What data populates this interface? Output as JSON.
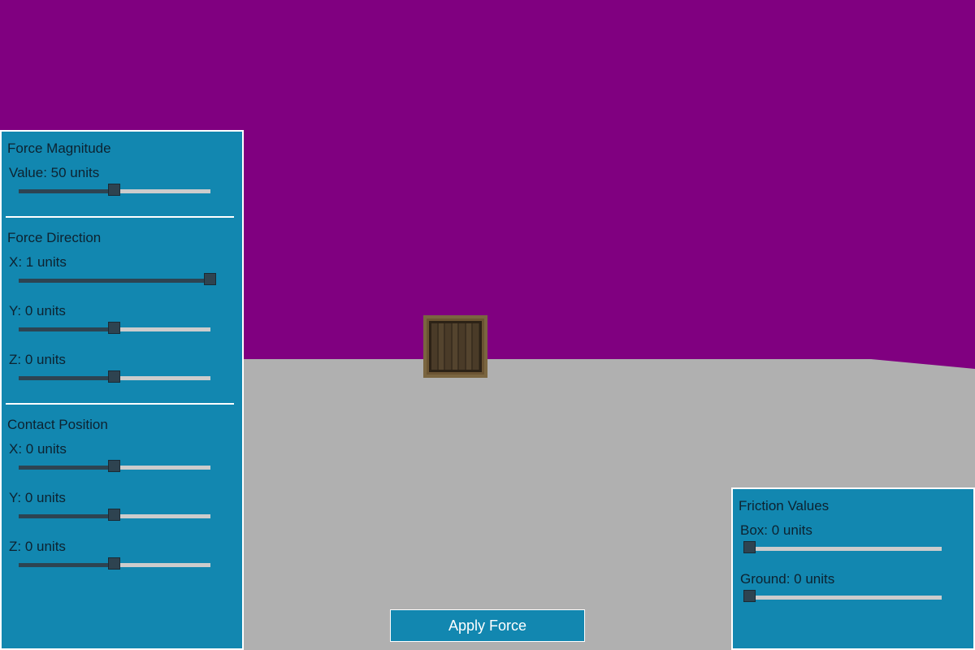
{
  "scene": {
    "sky_color": "#800080",
    "ground_color": "#b0b0b0",
    "object": "wooden-crate"
  },
  "force_magnitude": {
    "title": "Force Magnitude",
    "value": {
      "label": "Value: 50 units",
      "fraction": 0.5
    }
  },
  "force_direction": {
    "title": "Force Direction",
    "x": {
      "label": "X: 1 units",
      "fraction": 1.0
    },
    "y": {
      "label": "Y: 0 units",
      "fraction": 0.5
    },
    "z": {
      "label": "Z: 0 units",
      "fraction": 0.5
    }
  },
  "contact_position": {
    "title": "Contact Position",
    "x": {
      "label": "X: 0 units",
      "fraction": 0.5
    },
    "y": {
      "label": "Y: 0 units",
      "fraction": 0.5
    },
    "z": {
      "label": "Z: 0 units",
      "fraction": 0.5
    }
  },
  "friction": {
    "title": "Friction Values",
    "box": {
      "label": "Box: 0 units",
      "fraction": 0.0
    },
    "ground": {
      "label": "Ground: 0 units",
      "fraction": 0.0
    }
  },
  "apply_button": {
    "label": "Apply Force"
  },
  "colors": {
    "panel": "#1287b0",
    "slider_track": "#cccccc",
    "slider_fill": "#2d4452",
    "slider_thumb": "#2e4350"
  }
}
